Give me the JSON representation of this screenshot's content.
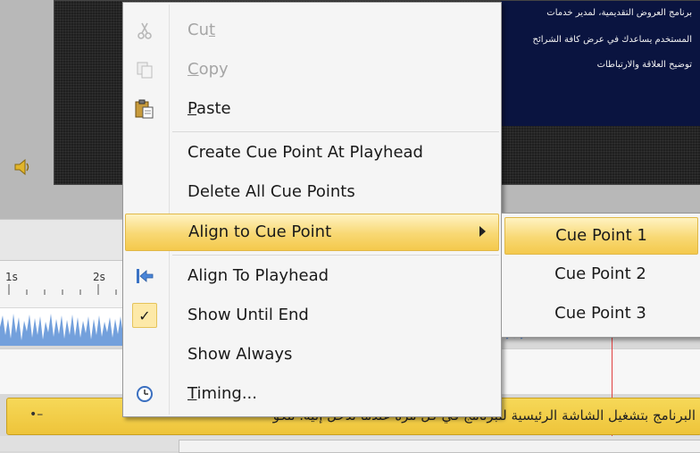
{
  "slide": {
    "lines": [
      "برنامج العروض التقديمية، لمدير خدمات",
      "المستخدم يساعدك في عرض كافة الشرائح",
      "توضيح العلاقة والارتباطات"
    ]
  },
  "timeline": {
    "ticks": [
      "1s",
      "2s"
    ]
  },
  "caption": {
    "text": "البرنامج بتشغيل الشاشة الرئيسية للبرنامج في كل مرة عندما تدخل إليه. تتكو",
    "handle": "•–"
  },
  "menu": {
    "items": [
      {
        "label": "Cut",
        "accel": "t",
        "icon": "scissors-icon",
        "enabled": false
      },
      {
        "label": "Copy",
        "accel": "C",
        "icon": "copy-icon",
        "enabled": false
      },
      {
        "label": "Paste",
        "accel": "P",
        "icon": "paste-icon",
        "enabled": true
      },
      {
        "label": "Create Cue Point At Playhead",
        "enabled": true
      },
      {
        "label": "Delete All Cue Points",
        "enabled": true
      },
      {
        "label": "Align to Cue Point",
        "enabled": true,
        "has_submenu": true,
        "highlighted": true
      },
      {
        "label": "Align To Playhead",
        "icon": "align-left-arrow-icon",
        "enabled": true
      },
      {
        "label": "Show Until End",
        "icon": "checkmark-icon",
        "checked": true,
        "enabled": true
      },
      {
        "label": "Show Always",
        "enabled": true
      },
      {
        "label": "Timing...",
        "accel": "T",
        "icon": "clock-icon",
        "enabled": true
      }
    ]
  },
  "submenu": {
    "items": [
      {
        "label": "Cue Point 1",
        "highlighted": true
      },
      {
        "label": "Cue Point 2"
      },
      {
        "label": "Cue Point 3"
      }
    ]
  },
  "colors": {
    "menu_highlight": "#f8d873",
    "caption_bar": "#eec43a",
    "playhead": "#e04040"
  }
}
